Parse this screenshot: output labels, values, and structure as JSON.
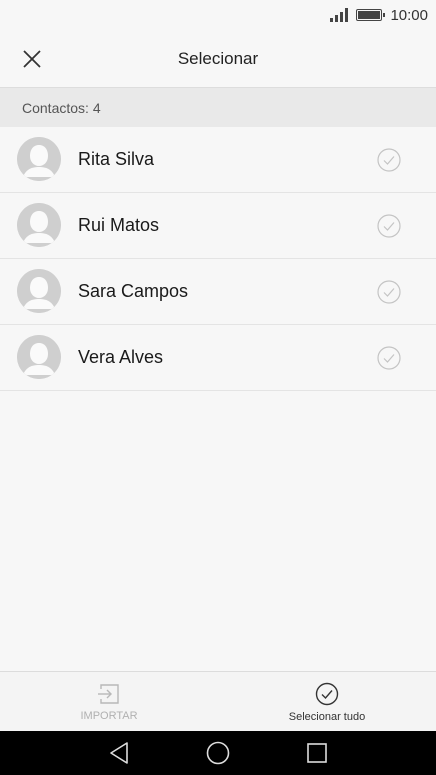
{
  "status_bar": {
    "time": "10:00"
  },
  "header": {
    "title": "Selecionar",
    "close_icon": "close-icon"
  },
  "subheader": {
    "label": "Contactos: 4"
  },
  "contacts": [
    {
      "name": "Rita Silva",
      "selected": false
    },
    {
      "name": "Rui Matos",
      "selected": false
    },
    {
      "name": "Sara Campos",
      "selected": false
    },
    {
      "name": "Vera Alves",
      "selected": false
    }
  ],
  "actions": {
    "import_label": "IMPORTAR",
    "import_enabled": false,
    "select_all_label": "Selecionar tudo"
  },
  "colors": {
    "background": "#f7f7f7",
    "subheader": "#e9e9e9",
    "avatar": "#cfcfcf",
    "nav_bar": "#000000"
  }
}
